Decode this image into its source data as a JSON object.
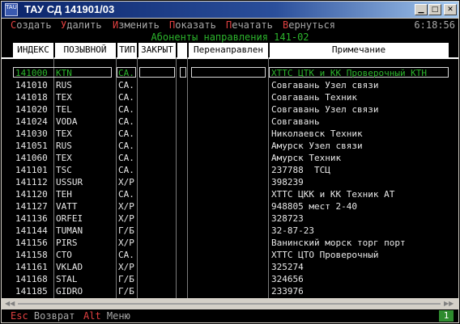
{
  "window": {
    "title": "ТАУ СД 141901/03",
    "icon_text": "TAU\nCD"
  },
  "menu": {
    "items": [
      {
        "hotkey": "С",
        "rest": "оздать"
      },
      {
        "hotkey": "У",
        "rest": "далить"
      },
      {
        "hotkey": "И",
        "rest": "зменить"
      },
      {
        "hotkey": "П",
        "rest": "оказать"
      },
      {
        "hotkey": "П",
        "rest": "ечатать"
      },
      {
        "hotkey": "В",
        "rest": "ернуться"
      }
    ],
    "clock": "6:18:56"
  },
  "table": {
    "heading": "Абоненты направления 141-02",
    "columns": [
      "ИНДЕКС",
      "ПОЗЫВНОЙ",
      "ТИП",
      "ЗАКРЫТ",
      "",
      "Перенаправлен",
      "Примечание"
    ],
    "selected_index": 0,
    "rows": [
      [
        "141000",
        "KTN",
        "СА.",
        "",
        "",
        "",
        "ХТТС ЦТК и КК Проверочный КТН"
      ],
      [
        "141010",
        "RUS",
        "СА.",
        "",
        "",
        "",
        "Совгавань Узел связи"
      ],
      [
        "141018",
        "TEX",
        "СА.",
        "",
        "",
        "",
        "Совгавань Техник"
      ],
      [
        "141020",
        "TEL",
        "СА.",
        "",
        "",
        "",
        "Совгавань Узел связи"
      ],
      [
        "141024",
        "VODA",
        "СА.",
        "",
        "",
        "",
        "Совгавань"
      ],
      [
        "141030",
        "TEX",
        "СА.",
        "",
        "",
        "",
        "Николаевск Техник"
      ],
      [
        "141051",
        "RUS",
        "СА.",
        "",
        "",
        "",
        "Амурск Узел связи"
      ],
      [
        "141060",
        "TEX",
        "СА.",
        "",
        "",
        "",
        "Амурск Техник"
      ],
      [
        "141101",
        "TSC",
        "СА.",
        "",
        "",
        "",
        "237788  ТСЦ"
      ],
      [
        "141112",
        "USSUR",
        "Х/Р",
        "",
        "",
        "",
        "398239"
      ],
      [
        "141120",
        "TEH",
        "СА.",
        "",
        "",
        "",
        "ХТТС ЦКК и КК Техник АТ"
      ],
      [
        "141127",
        "VATT",
        "Х/Р",
        "",
        "",
        "",
        "948805 мест 2-40"
      ],
      [
        "141136",
        "ORFEI",
        "Х/Р",
        "",
        "",
        "",
        "328723"
      ],
      [
        "141144",
        "TUMAN",
        "Г/Б",
        "",
        "",
        "",
        "32-87-23"
      ],
      [
        "141156",
        "PIRS",
        "Х/Р",
        "",
        "",
        "",
        "Ванинский морск торг порт"
      ],
      [
        "141158",
        "CTO",
        "СА.",
        "",
        "",
        "",
        "ХТТС ЦТО Проверочный"
      ],
      [
        "141161",
        "VKLAD",
        "Х/Р",
        "",
        "",
        "",
        "325274"
      ],
      [
        "141168",
        "STAL",
        "Г/Б",
        "",
        "",
        "",
        "324656"
      ],
      [
        "141185",
        "GIDRO",
        "Г/Б",
        "",
        "",
        "",
        "233976"
      ]
    ]
  },
  "keys": [
    {
      "key": "Esc",
      "label": "Возврат"
    },
    {
      "key": "Alt",
      "label": "Меню"
    }
  ],
  "page_indicator": "1",
  "colors": {
    "terminal_bg": "#000000",
    "text": "#e8e8e8",
    "accent_green": "#2cb52c",
    "hotkey_red": "#e04040",
    "titlebar": "#0a246a"
  }
}
